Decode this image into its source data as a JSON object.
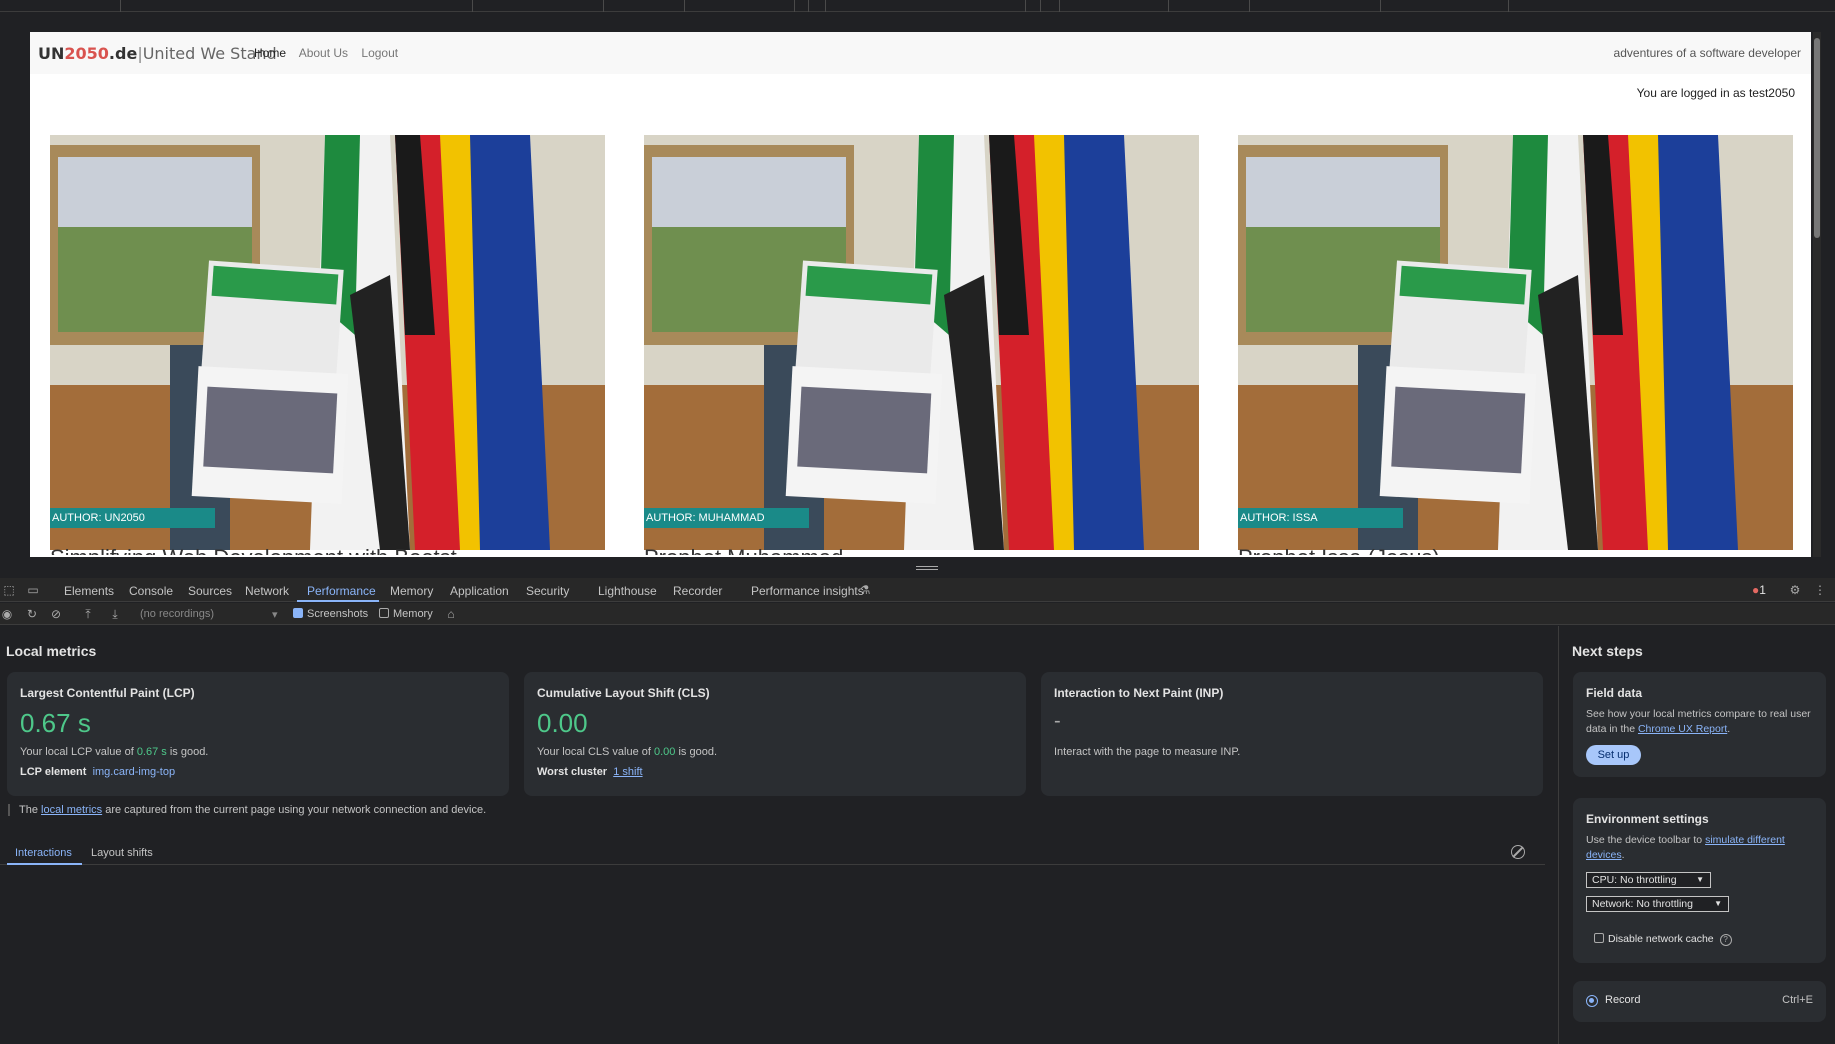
{
  "site": {
    "brand_un": "UN",
    "brand_2050": "2050",
    "brand_de": ".de",
    "brand_sep": "|",
    "brand_slogan": "United We Stand",
    "nav": [
      "Home",
      "About Us",
      "Logout"
    ],
    "nav_right": "adventures of a software developer",
    "logged_in": "You are logged in as test2050",
    "cards": [
      {
        "author": "AUTHOR: UN2050",
        "title": "Simplifying Web Development with Bootst"
      },
      {
        "author": "AUTHOR: MUHAMMAD",
        "title": "Prophet Muhammad"
      },
      {
        "author": "AUTHOR: ISSA",
        "title": "Prophet Issa (Jesus)"
      }
    ]
  },
  "devtools": {
    "tabs": [
      "Elements",
      "Console",
      "Sources",
      "Network",
      "Performance",
      "Memory",
      "Application",
      "Security",
      "Lighthouse",
      "Recorder",
      "Performance insights"
    ],
    "active_tab": "Performance",
    "error_count": "1",
    "toolbar": {
      "recordings_placeholder": "(no recordings)",
      "screenshots_label": "Screenshots",
      "memory_label": "Memory"
    },
    "local_metrics": {
      "title": "Local metrics",
      "lcp": {
        "title": "Largest Contentful Paint (LCP)",
        "value": "0.67 s",
        "desc_pre": "Your local LCP value of ",
        "desc_val": "0.67 s",
        "desc_post": " is good.",
        "element_label": "LCP element",
        "element_value": "img.card-img-top"
      },
      "cls": {
        "title": "Cumulative Layout Shift (CLS)",
        "value": "0.00",
        "desc_pre": "Your local CLS value of ",
        "desc_val": "0.00",
        "desc_post": " is good.",
        "cluster_label": "Worst cluster",
        "cluster_value": "1 shift"
      },
      "inp": {
        "title": "Interaction to Next Paint (INP)",
        "value": "-",
        "desc": "Interact with the page to measure INP."
      },
      "note_pre": "The ",
      "note_link": "local metrics",
      "note_post": " are captured from the current page using your network connection and device.",
      "subtabs": [
        "Interactions",
        "Layout shifts"
      ]
    },
    "next_steps": {
      "title": "Next steps",
      "field_data": {
        "title": "Field data",
        "desc": "See how your local metrics compare to real user data in the ",
        "link": "Chrome UX Report",
        "desc_end": ".",
        "button": "Set up"
      },
      "env": {
        "title": "Environment settings",
        "desc": "Use the device toolbar to ",
        "link": "simulate different devices",
        "desc_end": ".",
        "cpu": "CPU: No throttling",
        "network": "Network: No throttling",
        "disable_cache": "Disable network cache"
      },
      "record": {
        "label": "Record",
        "shortcut": "Ctrl+E"
      }
    }
  },
  "colors": {
    "accent": "#8ab4f8",
    "good": "#4ec88a",
    "badge": "#1a8a88",
    "brand_red": "#d9534f"
  }
}
